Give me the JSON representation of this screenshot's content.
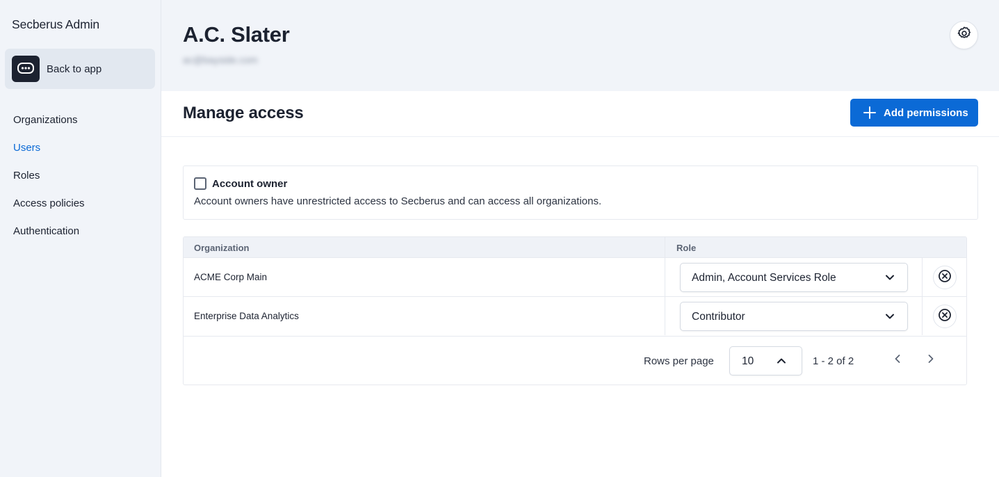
{
  "app": {
    "title": "Secberus Admin"
  },
  "sidebar": {
    "back_button": {
      "label": "Back to app",
      "icon": "chat-bubble-icon"
    },
    "items": [
      {
        "label": "Organizations",
        "active": false
      },
      {
        "label": "Users",
        "active": true
      },
      {
        "label": "Roles",
        "active": false
      },
      {
        "label": "Access policies",
        "active": false
      },
      {
        "label": "Authentication",
        "active": false
      }
    ]
  },
  "header": {
    "user_name": "A.C. Slater",
    "user_email": "ac@bayside.com",
    "settings_icon": "gear-icon"
  },
  "section": {
    "title": "Manage access",
    "add_button_label": "Add permissions"
  },
  "account_owner": {
    "checked": false,
    "label": "Account owner",
    "description": "Account owners have unrestricted access to Secberus and can access all organizations."
  },
  "table": {
    "headers": {
      "organization": "Organization",
      "role": "Role"
    },
    "rows": [
      {
        "organization": "ACME Corp Main",
        "role": "Admin, Account Services Role"
      },
      {
        "organization": "Enterprise Data Analytics",
        "role": "Contributor"
      }
    ]
  },
  "pagination": {
    "rows_per_page_label": "Rows per page",
    "rows_per_page_value": "10",
    "range_text": "1 - 2 of 2"
  },
  "colors": {
    "accent": "#0b6ad6",
    "sidebar_bg": "#f1f4f9",
    "text": "#1c2230"
  }
}
